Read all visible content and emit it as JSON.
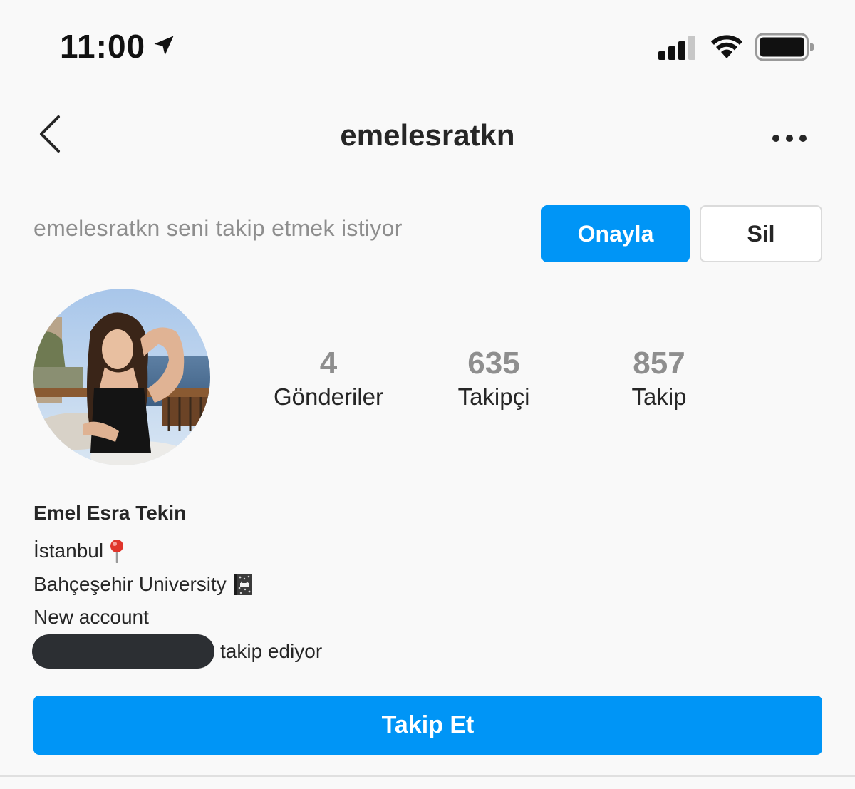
{
  "status_bar": {
    "time": "11:00",
    "icons": [
      "location-arrow-icon",
      "cellular-signal-icon",
      "wifi-icon",
      "battery-icon"
    ]
  },
  "header": {
    "username": "emelesratkn",
    "back_icon": "chevron-left-icon",
    "more_icon": "more-horizontal-icon"
  },
  "follow_request": {
    "text": "emelesratkn seni takip etmek istiyor",
    "approve_label": "Onayla",
    "remove_label": "Sil"
  },
  "profile": {
    "avatar": "profile-photo",
    "stats": [
      {
        "value": "4",
        "label": "Gönderiler"
      },
      {
        "value": "635",
        "label": "Takipçi"
      },
      {
        "value": "857",
        "label": "Takip"
      }
    ],
    "name": "Emel Esra Tekin",
    "bio_lines": [
      {
        "text": "İstanbul",
        "icon": "round-pushpin-icon"
      },
      {
        "text": "Bahçeşehir University",
        "icon": "composition-notebook-icon"
      },
      {
        "text": "New account"
      }
    ],
    "followed_by_text": "takip ediyor",
    "followed_by_redacted": true
  },
  "actions": {
    "follow_label": "Takip Et"
  },
  "colors": {
    "accent": "#0095f6",
    "background": "#f9f9f9",
    "text_primary": "#262626",
    "text_secondary": "#8e8e8e",
    "border": "#dbdbdb"
  }
}
